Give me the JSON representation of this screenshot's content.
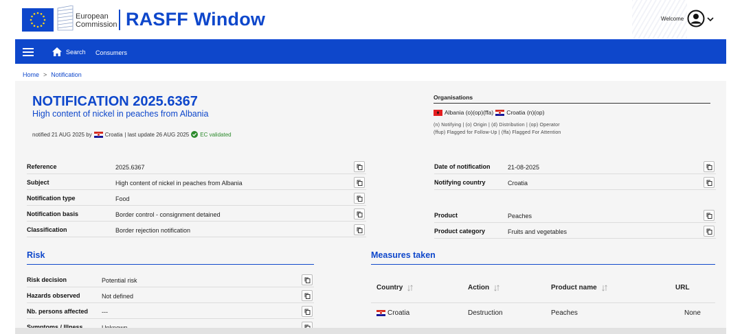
{
  "header": {
    "org_line1": "European",
    "org_line2": "Commission",
    "app_title": "RASFF Window",
    "welcome": "Welcome"
  },
  "nav": {
    "search_label": "Search",
    "consumers_label": "Consumers"
  },
  "breadcrumb": {
    "home": "Home",
    "separator": ">",
    "current": "Notification"
  },
  "notification": {
    "title": "NOTIFICATION 2025.6367",
    "subtitle": "High content of nickel in peaches from Albania",
    "meta_notified": "notified 21 AUG 2025 by",
    "meta_country": "Croatia",
    "meta_update": "| last update 26 AUG 2025",
    "meta_validated": "EC validated"
  },
  "organisations": {
    "heading": "Organisations",
    "country1": "Albania (o)(op)(ffa)",
    "country2": "Croatia (n)(op)",
    "legend1": "(n) Notifying | (o) Origin | (d) Distribution | (op) Operator",
    "legend2": "(ffup) Flagged for Follow-Up | (ffa) Flagged For Attention"
  },
  "details_left": [
    {
      "label": "Reference",
      "value": "2025.6367"
    },
    {
      "label": "Subject",
      "value": "High content of nickel in peaches from Albania"
    },
    {
      "label": "Notification type",
      "value": "Food"
    },
    {
      "label": "Notification basis",
      "value": "Border control - consignment detained"
    },
    {
      "label": "Classification",
      "value": "Border rejection notification"
    }
  ],
  "details_right": [
    {
      "label": "Date of notification",
      "value": "21-08-2025"
    },
    {
      "label": "Notifying country",
      "value": "Croatia"
    },
    {
      "label": "Product",
      "value": "Peaches"
    },
    {
      "label": "Product category",
      "value": "Fruits and vegetables"
    }
  ],
  "risk": {
    "heading": "Risk",
    "rows": [
      {
        "label": "Risk decision",
        "value": "Potential risk"
      },
      {
        "label": "Hazards observed",
        "value": "Not defined"
      },
      {
        "label": "Nb. persons affected",
        "value": "---"
      },
      {
        "label": "Symptoms / Illness",
        "value": "Unknown"
      }
    ]
  },
  "measures": {
    "heading": "Measures taken",
    "columns": [
      "Country",
      "Action",
      "Product name",
      "URL"
    ],
    "rows": [
      {
        "country": "Croatia",
        "action": "Destruction",
        "product": "Peaches",
        "url": "None"
      }
    ]
  },
  "colors": {
    "brand_blue": "#0e47cb",
    "validated_green": "#2c8a2c"
  },
  "icons": {
    "menu": "hamburger-icon",
    "home": "home-icon",
    "user": "user-circle-icon",
    "copy": "copy-icon",
    "sort": "sort-icon",
    "check": "check-circle-icon"
  }
}
